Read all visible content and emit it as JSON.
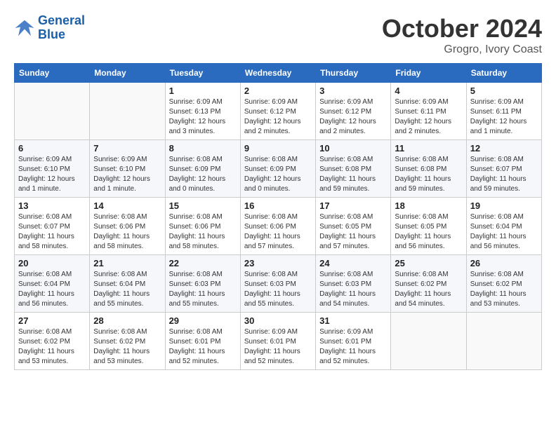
{
  "header": {
    "logo_line1": "General",
    "logo_line2": "Blue",
    "month": "October 2024",
    "location": "Grogro, Ivory Coast"
  },
  "weekdays": [
    "Sunday",
    "Monday",
    "Tuesday",
    "Wednesday",
    "Thursday",
    "Friday",
    "Saturday"
  ],
  "weeks": [
    [
      {
        "day": "",
        "info": ""
      },
      {
        "day": "",
        "info": ""
      },
      {
        "day": "1",
        "info": "Sunrise: 6:09 AM\nSunset: 6:13 PM\nDaylight: 12 hours\nand 3 minutes."
      },
      {
        "day": "2",
        "info": "Sunrise: 6:09 AM\nSunset: 6:12 PM\nDaylight: 12 hours\nand 2 minutes."
      },
      {
        "day": "3",
        "info": "Sunrise: 6:09 AM\nSunset: 6:12 PM\nDaylight: 12 hours\nand 2 minutes."
      },
      {
        "day": "4",
        "info": "Sunrise: 6:09 AM\nSunset: 6:11 PM\nDaylight: 12 hours\nand 2 minutes."
      },
      {
        "day": "5",
        "info": "Sunrise: 6:09 AM\nSunset: 6:11 PM\nDaylight: 12 hours\nand 1 minute."
      }
    ],
    [
      {
        "day": "6",
        "info": "Sunrise: 6:09 AM\nSunset: 6:10 PM\nDaylight: 12 hours\nand 1 minute."
      },
      {
        "day": "7",
        "info": "Sunrise: 6:09 AM\nSunset: 6:10 PM\nDaylight: 12 hours\nand 1 minute."
      },
      {
        "day": "8",
        "info": "Sunrise: 6:08 AM\nSunset: 6:09 PM\nDaylight: 12 hours\nand 0 minutes."
      },
      {
        "day": "9",
        "info": "Sunrise: 6:08 AM\nSunset: 6:09 PM\nDaylight: 12 hours\nand 0 minutes."
      },
      {
        "day": "10",
        "info": "Sunrise: 6:08 AM\nSunset: 6:08 PM\nDaylight: 11 hours\nand 59 minutes."
      },
      {
        "day": "11",
        "info": "Sunrise: 6:08 AM\nSunset: 6:08 PM\nDaylight: 11 hours\nand 59 minutes."
      },
      {
        "day": "12",
        "info": "Sunrise: 6:08 AM\nSunset: 6:07 PM\nDaylight: 11 hours\nand 59 minutes."
      }
    ],
    [
      {
        "day": "13",
        "info": "Sunrise: 6:08 AM\nSunset: 6:07 PM\nDaylight: 11 hours\nand 58 minutes."
      },
      {
        "day": "14",
        "info": "Sunrise: 6:08 AM\nSunset: 6:06 PM\nDaylight: 11 hours\nand 58 minutes."
      },
      {
        "day": "15",
        "info": "Sunrise: 6:08 AM\nSunset: 6:06 PM\nDaylight: 11 hours\nand 58 minutes."
      },
      {
        "day": "16",
        "info": "Sunrise: 6:08 AM\nSunset: 6:06 PM\nDaylight: 11 hours\nand 57 minutes."
      },
      {
        "day": "17",
        "info": "Sunrise: 6:08 AM\nSunset: 6:05 PM\nDaylight: 11 hours\nand 57 minutes."
      },
      {
        "day": "18",
        "info": "Sunrise: 6:08 AM\nSunset: 6:05 PM\nDaylight: 11 hours\nand 56 minutes."
      },
      {
        "day": "19",
        "info": "Sunrise: 6:08 AM\nSunset: 6:04 PM\nDaylight: 11 hours\nand 56 minutes."
      }
    ],
    [
      {
        "day": "20",
        "info": "Sunrise: 6:08 AM\nSunset: 6:04 PM\nDaylight: 11 hours\nand 56 minutes."
      },
      {
        "day": "21",
        "info": "Sunrise: 6:08 AM\nSunset: 6:04 PM\nDaylight: 11 hours\nand 55 minutes."
      },
      {
        "day": "22",
        "info": "Sunrise: 6:08 AM\nSunset: 6:03 PM\nDaylight: 11 hours\nand 55 minutes."
      },
      {
        "day": "23",
        "info": "Sunrise: 6:08 AM\nSunset: 6:03 PM\nDaylight: 11 hours\nand 55 minutes."
      },
      {
        "day": "24",
        "info": "Sunrise: 6:08 AM\nSunset: 6:03 PM\nDaylight: 11 hours\nand 54 minutes."
      },
      {
        "day": "25",
        "info": "Sunrise: 6:08 AM\nSunset: 6:02 PM\nDaylight: 11 hours\nand 54 minutes."
      },
      {
        "day": "26",
        "info": "Sunrise: 6:08 AM\nSunset: 6:02 PM\nDaylight: 11 hours\nand 53 minutes."
      }
    ],
    [
      {
        "day": "27",
        "info": "Sunrise: 6:08 AM\nSunset: 6:02 PM\nDaylight: 11 hours\nand 53 minutes."
      },
      {
        "day": "28",
        "info": "Sunrise: 6:08 AM\nSunset: 6:02 PM\nDaylight: 11 hours\nand 53 minutes."
      },
      {
        "day": "29",
        "info": "Sunrise: 6:08 AM\nSunset: 6:01 PM\nDaylight: 11 hours\nand 52 minutes."
      },
      {
        "day": "30",
        "info": "Sunrise: 6:09 AM\nSunset: 6:01 PM\nDaylight: 11 hours\nand 52 minutes."
      },
      {
        "day": "31",
        "info": "Sunrise: 6:09 AM\nSunset: 6:01 PM\nDaylight: 11 hours\nand 52 minutes."
      },
      {
        "day": "",
        "info": ""
      },
      {
        "day": "",
        "info": ""
      }
    ]
  ]
}
